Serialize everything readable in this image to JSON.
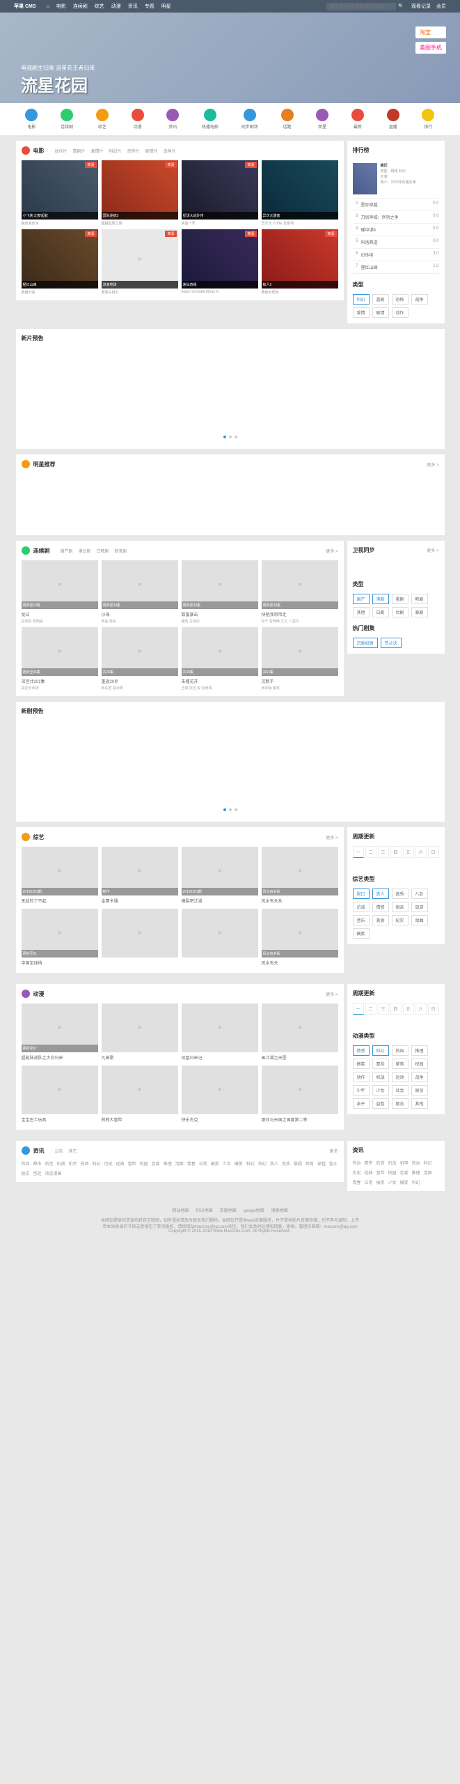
{
  "topbar": {
    "logo": "苹果 CMS",
    "home_icon": "⌂",
    "nav": [
      "电影",
      "连续剧",
      "综艺",
      "动漫",
      "资讯",
      "专题",
      "明星"
    ],
    "search_placeholder": "输入影片片名或演员名称",
    "right": [
      "观看记录",
      "会员"
    ]
  },
  "hero": {
    "title": "流星花园",
    "subtitle": "电视剧主归来 流星花王者归来",
    "badges": [
      "淘宝",
      "美图手机"
    ]
  },
  "icons": [
    {
      "label": "电影",
      "color": "#3498db"
    },
    {
      "label": "连续剧",
      "color": "#2ecc71"
    },
    {
      "label": "综艺",
      "color": "#f39c12"
    },
    {
      "label": "动漫",
      "color": "#e74c3c"
    },
    {
      "label": "资讯",
      "color": "#9b59b6"
    },
    {
      "label": "热播电影",
      "color": "#1abc9c"
    },
    {
      "label": "同步剧场",
      "color": "#3498db"
    },
    {
      "label": "话题",
      "color": "#e67e22"
    },
    {
      "label": "明星",
      "color": "#9b59b6"
    },
    {
      "label": "最新",
      "color": "#e74c3c"
    },
    {
      "label": "直播",
      "color": "#c0392b"
    },
    {
      "label": "排行",
      "color": "#f1c40f"
    }
  ],
  "movie": {
    "title": "电影",
    "tabs": [
      "动作片",
      "喜剧片",
      "爱情片",
      "科幻片",
      "恐怖片",
      "剧情片",
      "战争片"
    ],
    "more": "更多 >",
    "items": [
      {
        "title": "小飞侠 幻梦起航",
        "sub": "狼叔演反派",
        "badge": "高清",
        "cls": "p1"
      },
      {
        "title": "国际迷航3",
        "sub": "超越星辰之旅",
        "badge": "高清",
        "cls": "p2"
      },
      {
        "title": "星球大战外传",
        "sub": "侠盗一号",
        "badge": "高清",
        "cls": "p3"
      },
      {
        "title": "异次元骇客",
        "sub": "异次元 CUBE 全系列",
        "badge": "",
        "cls": "p4"
      },
      {
        "title": "猩红山峰",
        "sub": "英雄归来",
        "badge": "高清",
        "cls": "p5"
      },
      {
        "title": "流浪地球",
        "sub": "老谋子科幻",
        "badge": "高清",
        "cls": "p6"
      },
      {
        "title": "速仙奇缘",
        "sub": "Adam Schindler/Brian N",
        "badge": "高清",
        "cls": "p7"
      },
      {
        "title": "蚁人2",
        "sub": "黄蜂女现身",
        "badge": "高清",
        "cls": "p8"
      }
    ]
  },
  "rank": {
    "title": "排行榜",
    "featured": {
      "title": "我们",
      "meta": "类型：网络 科幻",
      "actors": "主演：",
      "info": "简介：2025年的浦东某"
    },
    "items": [
      {
        "num": "2",
        "name": "星际穿越",
        "score": "0.0"
      },
      {
        "num": "3",
        "name": "刀剑神域：序列之争",
        "score": "0.0"
      },
      {
        "num": "4",
        "name": "碟中谍6",
        "score": "0.0"
      },
      {
        "num": "5",
        "name": "科洛弗道",
        "score": "0.0"
      },
      {
        "num": "6",
        "name": "幻体埃",
        "score": "3.0"
      },
      {
        "num": "7",
        "name": "猩红山峰",
        "score": "1.0"
      }
    ],
    "type_title": "类型",
    "types": [
      "科幻",
      "喜剧",
      "恐怖",
      "战争",
      "爱情",
      "剧情",
      "动作"
    ]
  },
  "new_trailer": "新片预告",
  "star_rec": {
    "title": "明星推荐",
    "more": "更多 >"
  },
  "tv": {
    "title": "连续剧",
    "tabs": [
      "国产剧",
      "港台剧",
      "日韩剧",
      "欧美剧"
    ],
    "more": "更多 >",
    "items": [
      {
        "title": "龙日",
        "sub": "关晓彤 侯明昊",
        "cap": "更新至10集"
      },
      {
        "title": "沙海",
        "sub": "吴磊 秦昊",
        "cap": "更新至34集"
      },
      {
        "title": "甜蜜暴击",
        "sub": "鹿晗 关晓彤",
        "cap": "更新至30集"
      },
      {
        "title": "快把我哥带走",
        "sub": "孙千 曾舜晞 王文 卜冠今",
        "cap": "更新至30集"
      },
      {
        "title": "深宫计201集",
        "sub": "胡定欣出场",
        "cap": "更新至36集"
      },
      {
        "title": "重返20岁",
        "sub": "韩东君 胡冰卿",
        "cap": "共26集"
      },
      {
        "title": "朱槿花开",
        "sub": "王岗 梁洁 俊 贾景晖",
        "cap": "共40集"
      },
      {
        "title": "沉默不",
        "sub": "吴卓翰 秦岚",
        "cap": "共54集"
      }
    ]
  },
  "tv_side": {
    "title": "卫视同步",
    "more": "更多 >",
    "type_title": "类型",
    "types": [
      "国产",
      "港剧",
      "美剧",
      "韩剧",
      "其他",
      "日剧",
      "台剧",
      "泰剧"
    ],
    "hot_title": "热门剧集",
    "hot": [
      "沉香如屑",
      "苍兰诀"
    ]
  },
  "new_tv": "新剧预告",
  "variety": {
    "title": "综艺",
    "more": "更多 >",
    "items": [
      {
        "title": "无敌的了不起",
        "sub": "",
        "cap": "20190101期"
      },
      {
        "title": "金鹰卡通",
        "sub": "",
        "cap": "新作"
      },
      {
        "title": "爆裂吧江湖",
        "sub": "",
        "cap": "20190101期"
      },
      {
        "title": "风水有关系",
        "sub": "",
        "cap": "风水有关系"
      },
      {
        "title": "中国足球档",
        "sub": "",
        "cap": "更新至01"
      },
      {
        "title": "",
        "sub": "",
        "cap": ""
      },
      {
        "title": "",
        "sub": "",
        "cap": ""
      },
      {
        "title": "风水有关",
        "sub": "",
        "cap": "风水有关系"
      }
    ]
  },
  "variety_side": {
    "title": "周期更新",
    "week": [
      "一",
      "二",
      "三",
      "四",
      "五",
      "六",
      "日"
    ],
    "type_title": "综艺类型",
    "types": [
      "脱口",
      "真人",
      "选秀",
      "八卦",
      "访谈",
      "情感",
      "相亲",
      "旅游",
      "音乐",
      "美食",
      "纪实",
      "戏曲",
      "搞笑"
    ]
  },
  "anime": {
    "title": "动漫",
    "more": "更多 >",
    "items": [
      {
        "title": "超能陆战队之大白归来",
        "sub": "",
        "cap": "更新至07"
      },
      {
        "title": "凡高歌",
        "sub": "",
        "cap": ""
      },
      {
        "title": "凤凰归来记",
        "sub": "",
        "cap": ""
      },
      {
        "title": "画江湖之天罡",
        "sub": "",
        "cap": ""
      },
      {
        "title": "宝宝巴士玩具",
        "sub": "",
        "cap": ""
      },
      {
        "title": "熊熊大冒险",
        "sub": "",
        "cap": ""
      },
      {
        "title": "快乐杰克",
        "sub": "",
        "cap": ""
      },
      {
        "title": "娜莎与天国之国度第二季",
        "sub": "",
        "cap": ""
      }
    ]
  },
  "anime_side": {
    "title": "周期更新",
    "week": [
      "一",
      "二",
      "三",
      "四",
      "五",
      "六",
      "日"
    ],
    "type_title": "动漫类型",
    "types": [
      "情感",
      "科幻",
      "热血",
      "推理",
      "搞笑",
      "冒险",
      "萝莉",
      "校园",
      "动作",
      "机战",
      "运动",
      "战争",
      "少年",
      "少女",
      "社会",
      "原创",
      "亲子",
      "益智",
      "励志",
      "其他"
    ]
  },
  "news": {
    "title": "资讯",
    "tabs": [
      "公告",
      "其它"
    ],
    "more": "更多",
    "tags": [
      "热血",
      "都市",
      "后宫",
      "机战",
      "机甲",
      "热血",
      "科幻",
      "历史",
      "经典",
      "冒险",
      "校园",
      "恋爱",
      "推理",
      "泡面",
      "青春",
      "日常",
      "搞笑",
      "少女",
      "爆笑",
      "科幻",
      "奇幻",
      "真人",
      "竞技",
      "悬疑",
      "体育",
      "穿越",
      "智斗",
      "励志",
      "宫廷",
      "动态漫画"
    ]
  },
  "news_side": {
    "title": "资讯",
    "tags": [
      "热血",
      "都市",
      "后宫",
      "机战",
      "机甲",
      "热血",
      "科幻",
      "历史",
      "经典",
      "冒险",
      "校园",
      "恋爱",
      "推理",
      "泡面",
      "青春",
      "日常",
      "搞笑",
      "少女",
      "爆笑",
      "科幻"
    ]
  },
  "footer": {
    "links": [
      "网站地图",
      "RSS地图",
      "百度地图",
      "google地图",
      "搜索地图"
    ],
    "disclaimer": "本网站提供的资源均转自互联网，如有侵权请及时联系我们删除。本网站只提供web页面服务，并不提供影片资源存储，也不参与录制、上传",
    "contact": "若本站收录的节目无意侵犯了贵司版权，请给网站maccms@qq.com来信，我们会及时处理和回复，谢谢。管理员邮箱：maccms@qq.com",
    "copyright": "Copyright © 2015-2018 Www.MacCms.Com .All Rights Reserved ."
  }
}
